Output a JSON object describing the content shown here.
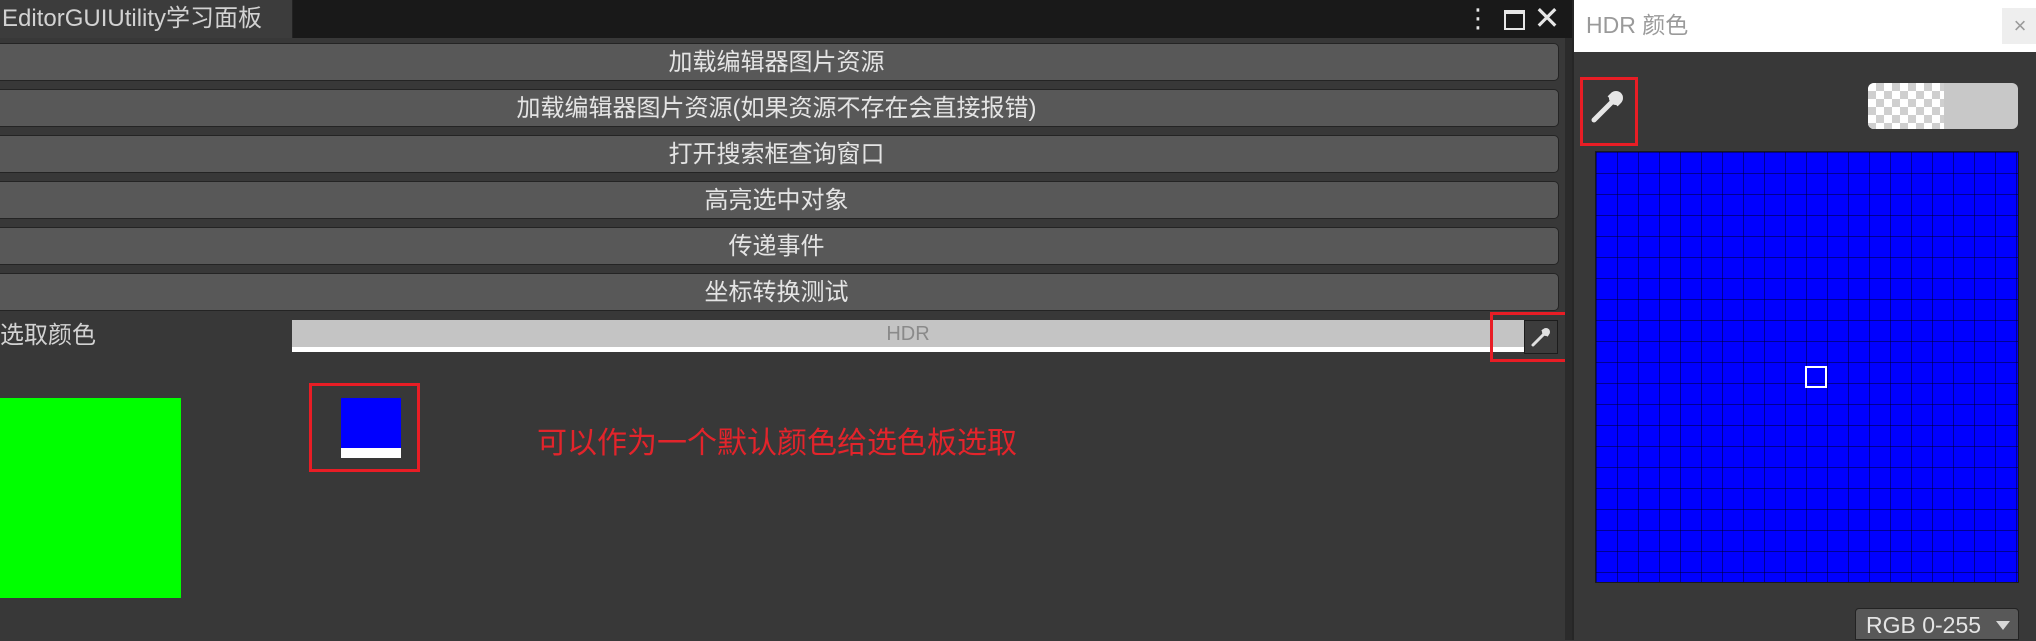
{
  "editor": {
    "tab_title": "EditorGUIUtility学习面板",
    "buttons": [
      "加载编辑器图片资源",
      "加载编辑器图片资源(如果资源不存在会直接报错)",
      "打开搜索框查询窗口",
      "高亮选中对象",
      "传递事件",
      "坐标转换测试"
    ],
    "color_field": {
      "label": "选取颜色",
      "badge": "HDR",
      "value": "#0000ff"
    },
    "swatch_color": "#00ff00",
    "annotation": "可以作为一个默认颜色给选色板选取",
    "annotation_color": "#e3242b",
    "window_controls": {
      "more": "⋮",
      "close": "✕"
    }
  },
  "color_picker": {
    "title": "HDR 颜色",
    "close": "×",
    "current_color": "#0000ff",
    "mode": "RGB 0-255"
  },
  "icons": [
    "more-icon",
    "maximize-icon",
    "close-icon",
    "eyedropper-icon",
    "dropdown-caret-icon"
  ]
}
